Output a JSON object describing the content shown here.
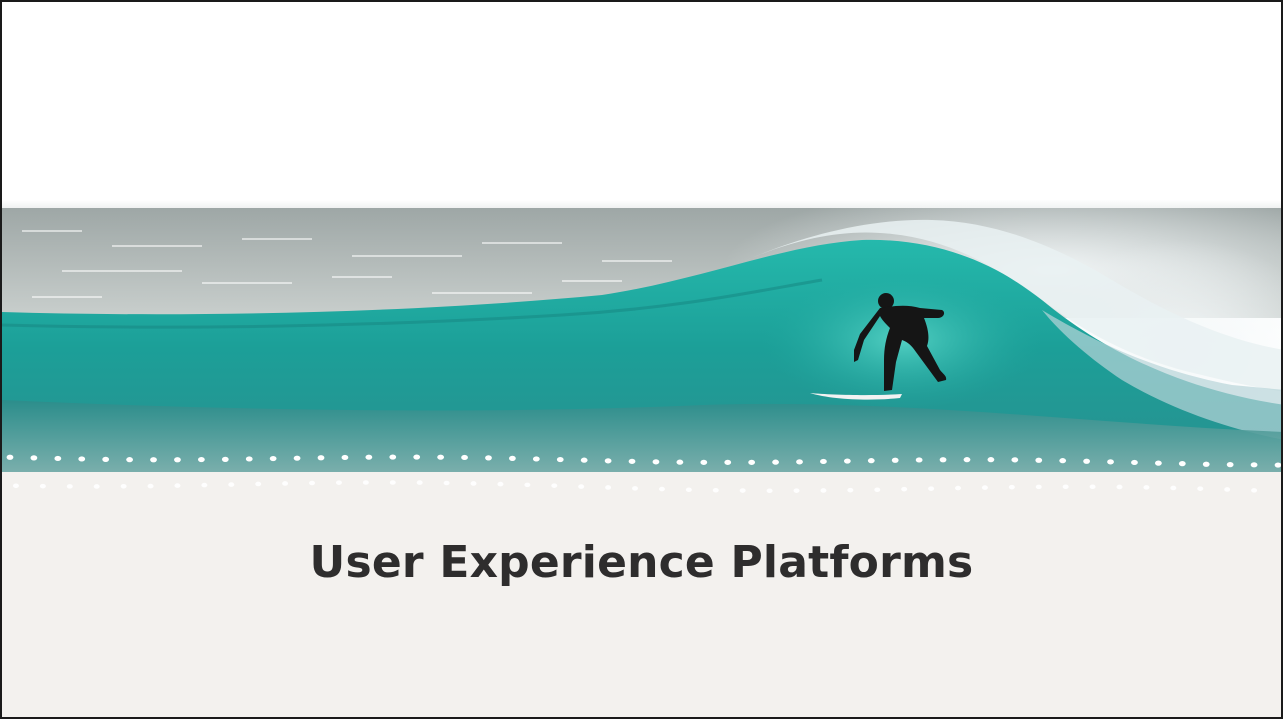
{
  "slide": {
    "title": "User Experience Platforms"
  },
  "hero_image": {
    "subject": "surfer riding a turquoise wave",
    "colors": {
      "wave_main": "#1fa9a0",
      "wave_dark": "#137a78",
      "sea_far": "#b9c1bf",
      "spray": "#e6eef0",
      "surfer": "#1a1a1a"
    }
  },
  "decoration": {
    "dot_color": "#ffffff",
    "background_lower": "#f3f1ee"
  }
}
